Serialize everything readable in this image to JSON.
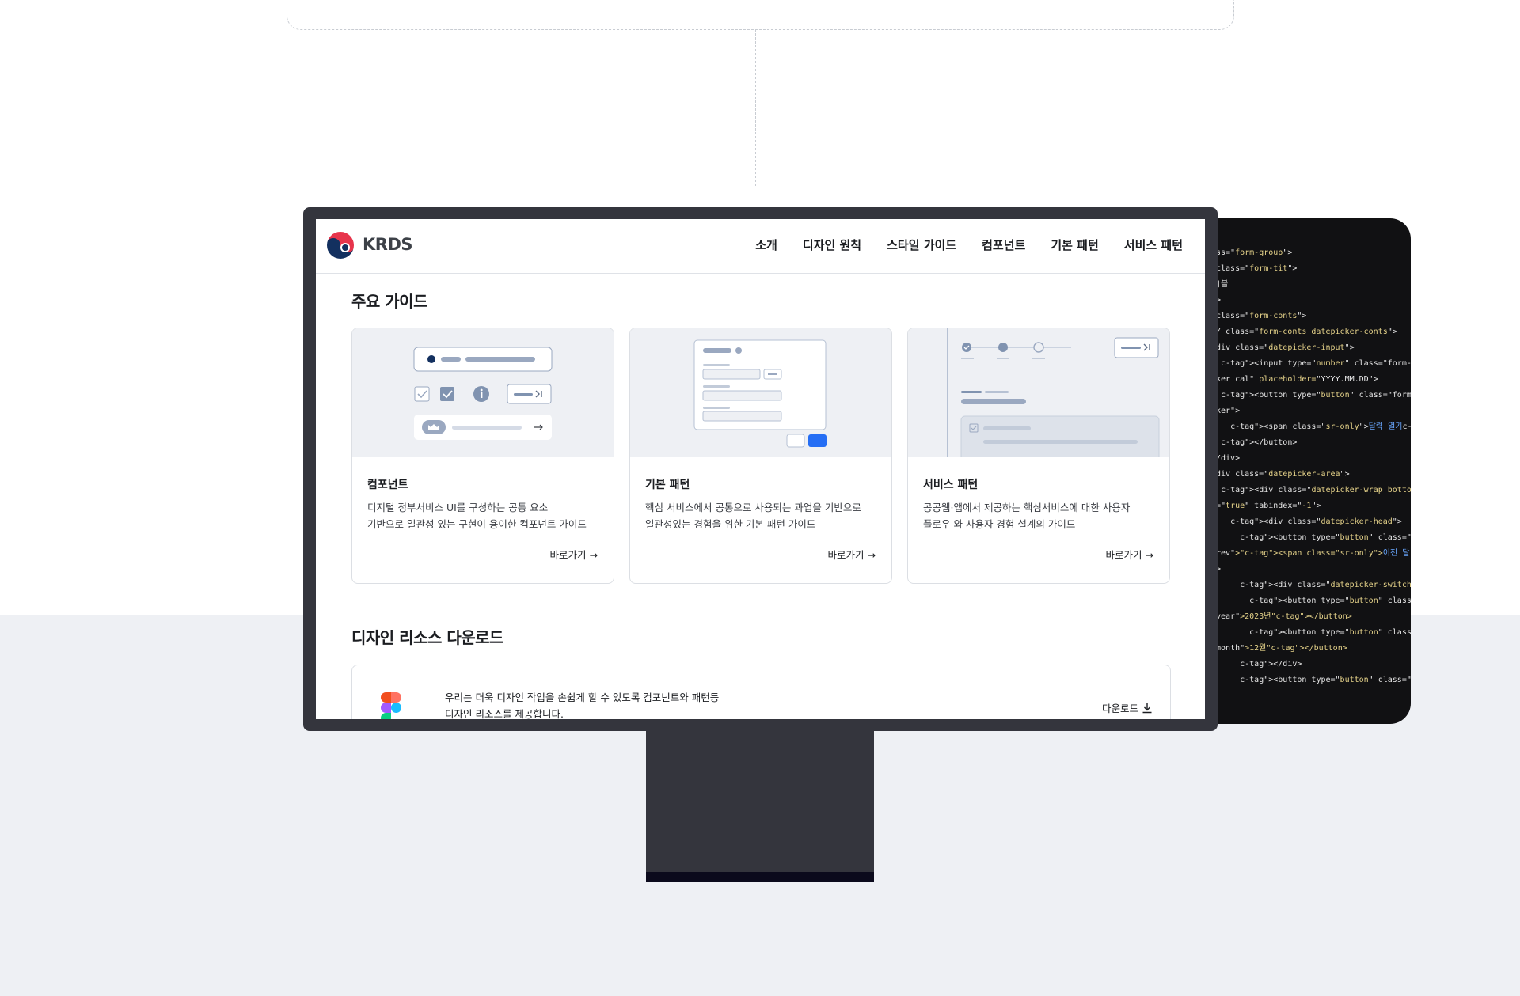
{
  "site": {
    "logo_text": "KRDS",
    "nav": [
      "소개",
      "디자인 원칙",
      "스타일 가이드",
      "컴포넌트",
      "기본 패턴",
      "서비스 패턴"
    ]
  },
  "guides": {
    "title": "주요 가이드",
    "cards": [
      {
        "title": "컴포넌트",
        "desc_line1": "디지털 정부서비스 UI를 구성하는 공통 요소",
        "desc_line2": "기반으로 일관성 있는 구현이 용이한 컴포넌트 가이드",
        "link": "바로가기"
      },
      {
        "title": "기본 패턴",
        "desc_line1": "핵심 서비스에서 공통으로 사용되는 과업을 기반으로",
        "desc_line2": "일관성있는 경험을 위한 기본 패턴 가이드",
        "link": "바로가기"
      },
      {
        "title": "서비스 패턴",
        "desc_line1": "공공웹·앱에서 제공하는 핵심서비스에 대한 사용자",
        "desc_line2": "플로우 와 사용자 경험 설계의 가이드",
        "link": "바로가기"
      }
    ]
  },
  "resources": {
    "title": "디자인 리소스 다운로드",
    "desc_line1": "우리는 더욱 디자인 작업을 손쉽게 할 수 있도록 컴포넌트와 패턴등",
    "desc_line2": "디자인 리소스를 제공합니다.",
    "download": "다운로드"
  },
  "code": {
    "lines": [
      "ss=\"form-group\">",
      "class=\"form-tit\">",
      "]블",
      ">",
      "class=\"form-conts\">",
      "/ class=\"form-conts datepicker-conts\">",
      "div class=\"datepicker-input\">",
      " <input type=\"number\" class=\"form-control",
      "ker cal\" placeholder=\"YYYY.MM.DD\">",
      " <button type=\"button\" class=\"form-btn-",
      "ker\">",
      "   <span class=\"sr-only\">달력 열기</span>",
      " </button>",
      "/div>",
      "div class=\"datepicker-area\">",
      " <div class=\"datepicker-wrap bottom\" aria-",
      "=\"true\" tabindex=\"-1\">",
      "   <div class=\"datepicker-head\">",
      "     <button type=\"button\" class=\"btn-cal-",
      "rev\"><span class=\"sr-only\">이전 달</span></",
      ">",
      "     <div class=\"datepicker-switch-wrap\">",
      "       <button type=\"button\" class=\"btn-cal-",
      "year\">2023년</button>",
      "       <button type=\"button\" class=\"btn-cal-",
      "month\">12월</button>",
      "     </div>",
      "     <button type=\"button\" class=\"btn-cal-…"
    ]
  },
  "colors": {
    "bezel": "#34353d",
    "code_bg": "#111113",
    "accent_blue": "#256ef4",
    "illu_bg": "#eef0f4"
  }
}
